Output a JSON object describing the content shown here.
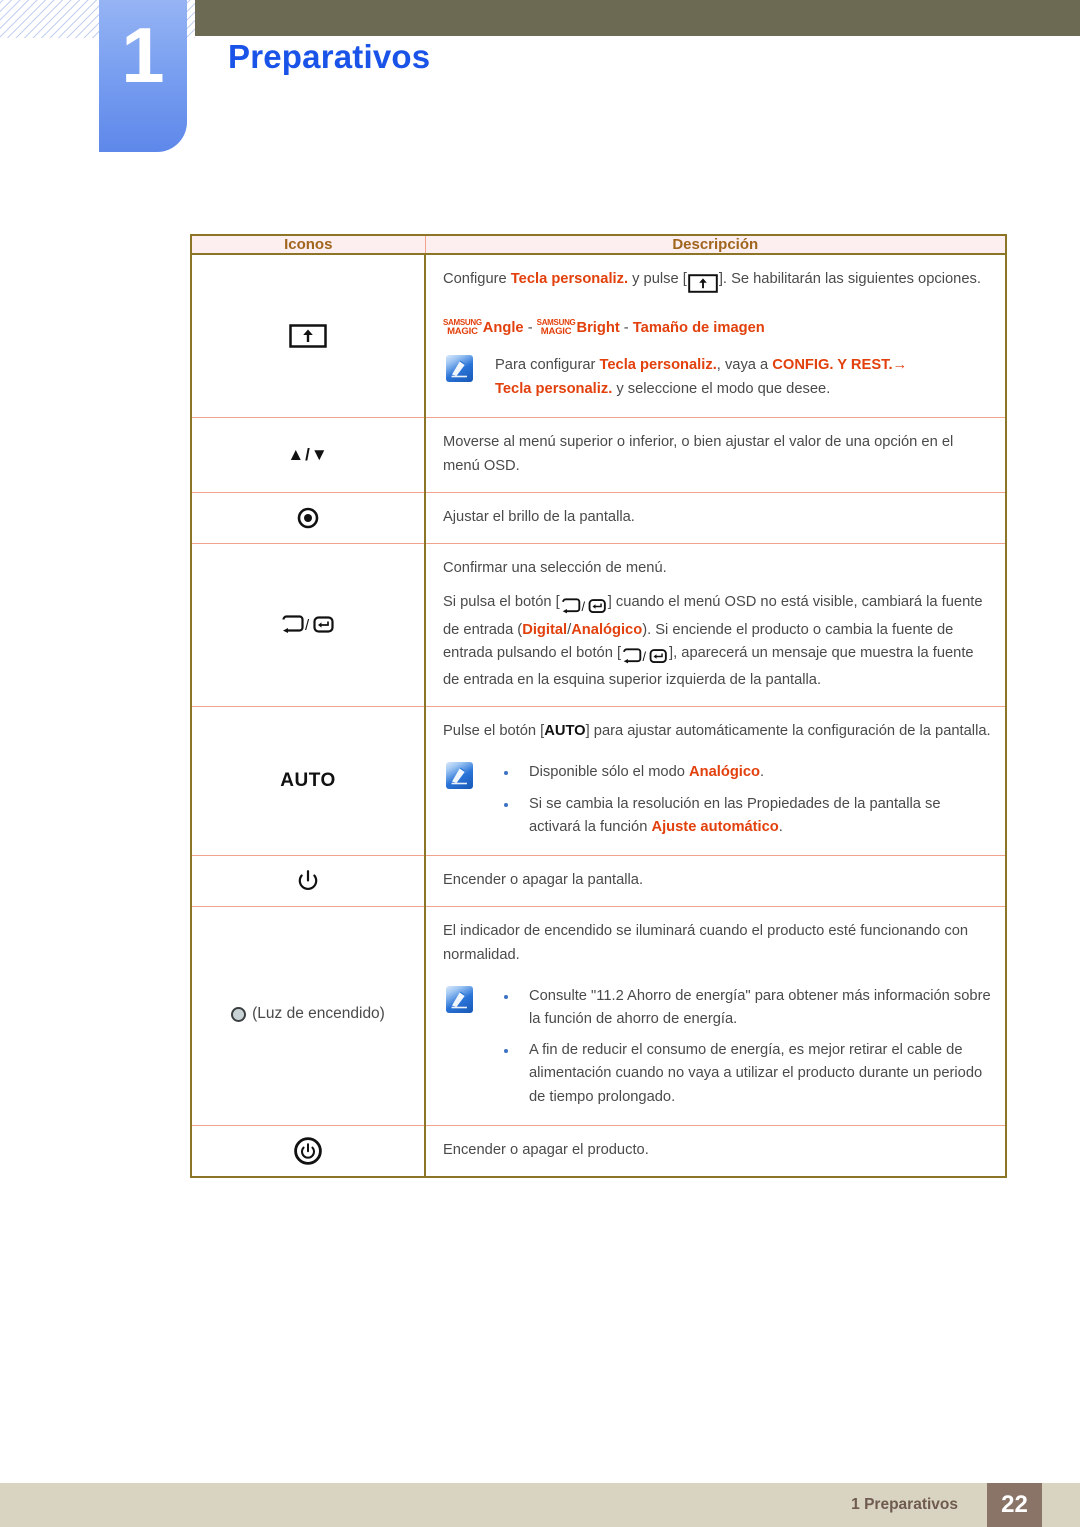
{
  "chapter": {
    "number": "1",
    "title": "Preparativos"
  },
  "table": {
    "headers": {
      "icons": "Iconos",
      "description": "Descripción"
    },
    "rows": [
      {
        "icon_name": "custom-key-arrow-icon",
        "icon_label": "",
        "desc": {
          "p1_a": "Configure ",
          "p1_hl": "Tecla personaliz.",
          "p1_b": " y pulse [",
          "p1_c": "]. Se habilitarán las siguientes opciones.",
          "magic_line": {
            "sup1_top": "SAMSUNG",
            "sup1_bottom": "MAGIC",
            "word1": "Angle",
            "sep1": " - ",
            "sup2_top": "SAMSUNG",
            "sup2_bottom": "MAGIC",
            "word2": "Bright",
            "sep2": " - ",
            "word3": "Tamaño de imagen"
          },
          "note_a": "Para configurar ",
          "note_hl1": "Tecla personaliz.",
          "note_b": ", vaya a ",
          "note_hl2": "CONFIG. Y REST.",
          "note_arrow": "→",
          "note_hl3": "Tecla personaliz.",
          "note_c": " y seleccione el modo que desee."
        }
      },
      {
        "icon_name": "up-down-arrows-icon",
        "icon_label": "▲/▼",
        "desc": {
          "p1": "Moverse al menú superior o inferior, o bien ajustar el valor de una opción en el menú OSD."
        }
      },
      {
        "icon_name": "brightness-dot-icon",
        "icon_label": "",
        "desc": {
          "p1": "Ajustar el brillo de la pantalla."
        }
      },
      {
        "icon_name": "source-enter-icon",
        "icon_label": "",
        "desc": {
          "p1": "Confirmar una selección de menú.",
          "p2_a": "Si pulsa el botón [",
          "p2_b": "] cuando el menú OSD no está visible, cambiará la fuente de entrada (",
          "p2_hl1": "Digital",
          "p2_slash": "/",
          "p2_hl2": "Analógico",
          "p2_c": "). Si enciende el producto o cambia la fuente de entrada pulsando el botón [",
          "p2_d": "], aparecerá un mensaje que muestra la fuente de entrada en la esquina superior izquierda de la pantalla."
        }
      },
      {
        "icon_name": "auto-button-icon",
        "icon_label": "AUTO",
        "desc": {
          "p1_a": "Pulse el botón [",
          "p1_key": "AUTO",
          "p1_b": "] para ajustar automáticamente la configuración de la pantalla.",
          "bullets": [
            {
              "a": "Disponible sólo el modo ",
              "hl": "Analógico",
              "b": "."
            },
            {
              "a": "Si se cambia la resolución en las Propiedades de la pantalla se activará la función ",
              "hl": "Ajuste automático",
              "b": "."
            }
          ]
        }
      },
      {
        "icon_name": "power-screen-icon",
        "icon_label": "",
        "desc": {
          "p1": "Encender o apagar la pantalla."
        }
      },
      {
        "icon_name": "power-led-icon",
        "icon_label": "(Luz de encendido)",
        "desc": {
          "p1": "El indicador de encendido se iluminará cuando el producto esté funcionando con normalidad.",
          "bullets": [
            {
              "a": "Consulte \"11.2 Ahorro de energía\" para obtener más información sobre la función de ahorro de energía.",
              "hl": "",
              "b": ""
            },
            {
              "a": "A fin de reducir el consumo de energía, es mejor retirar el cable de alimentación cuando no vaya a utilizar el producto durante un periodo de tiempo prolongado.",
              "hl": "",
              "b": ""
            }
          ]
        }
      },
      {
        "icon_name": "power-button-ring-icon",
        "icon_label": "",
        "desc": {
          "p1": "Encender o apagar el producto."
        }
      }
    ]
  },
  "footer": {
    "label": "1 Preparativos",
    "page": "22"
  },
  "colors": {
    "accent_blue": "#1a53e8",
    "highlight_orange": "#e2400c",
    "table_border": "#8c7526",
    "row_border": "#f0a48c",
    "header_bg": "#fdeef0",
    "header_text": "#a0651d",
    "topbar": "#6d6a53",
    "footer_bar": "#d9d3c1",
    "footer_page_bg": "#8a7467"
  }
}
